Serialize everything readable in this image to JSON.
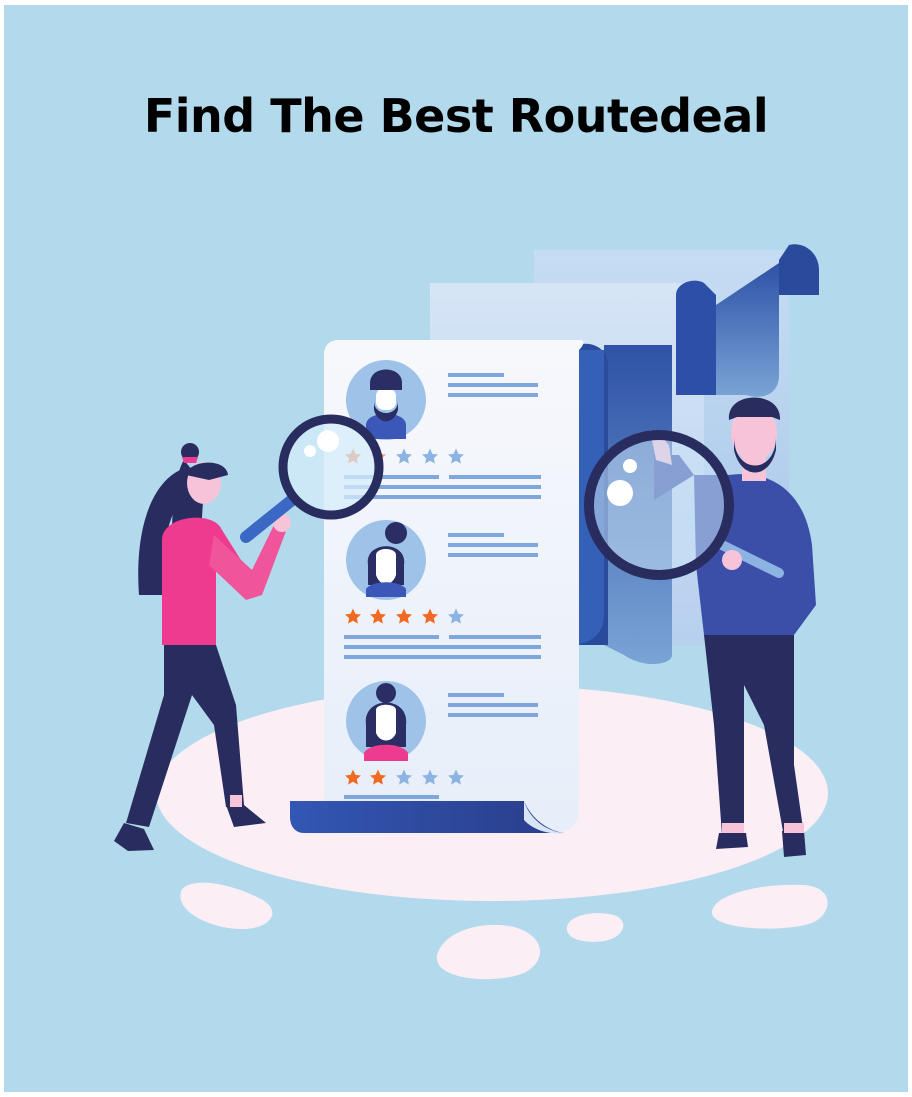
{
  "page": {
    "title": "Find The Best Routedeal"
  },
  "colors": {
    "background": "#b2daec",
    "navy": "#292c5e",
    "blue": "#3b58b8",
    "light_blue": "#8db3e2",
    "pink": "#ee3a8f",
    "star_orange": "#f06a23",
    "platform": "#fceef5"
  },
  "reviews": [
    {
      "avatar": "man-with-beard-avatar",
      "rating": 1.5,
      "max_rating": 5
    },
    {
      "avatar": "woman-with-bun-avatar",
      "rating": 4,
      "max_rating": 5
    },
    {
      "avatar": "woman-in-pink-avatar",
      "rating": 2,
      "max_rating": 5
    }
  ]
}
